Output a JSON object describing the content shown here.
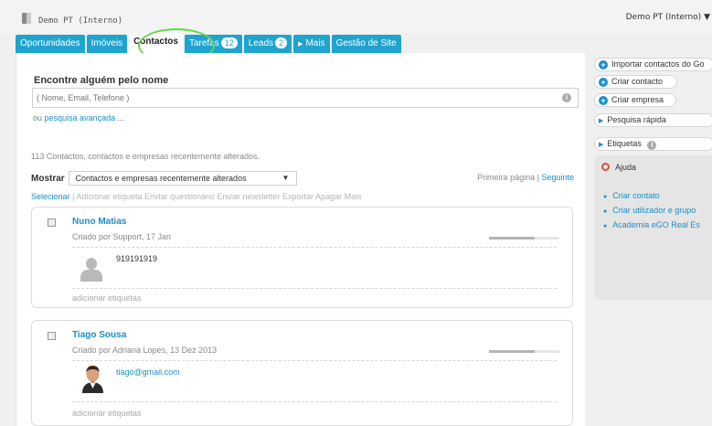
{
  "header": {
    "app_title": "Demo PT (Interno)",
    "account_select": "Demo PT (Interno)"
  },
  "tabs": [
    {
      "label": "Oportunidades"
    },
    {
      "label": "Imóveis"
    },
    {
      "label": "Contactos",
      "active": true
    },
    {
      "label": "Tarefas",
      "badge": "12"
    },
    {
      "label": "Leads",
      "badge": "2"
    },
    {
      "label": "Mais",
      "icon": "triangle-right-icon"
    },
    {
      "label": "Gestão de Site"
    }
  ],
  "search": {
    "title": "Encontre alguém pelo nome",
    "placeholder": "( Nome, Email, Telefone )",
    "or_text": "ou",
    "advanced_link": "pesquisa avançada ..."
  },
  "list": {
    "count_text": "113 Contactos, contactos e empresas recentemente alterados.",
    "show_label": "Mostrar",
    "show_value": "Contactos e empresas recentemente alterados",
    "pager_first": "Primeira página",
    "pager_sep": "|",
    "pager_next": "Seguinte",
    "actions": {
      "select": "Selecionar",
      "sep": "|",
      "rest": "Adicionar etiqueta Enviar questionário Enviar newsletter Exportar Apagar Mais"
    },
    "contacts": [
      {
        "name": "Nuno Matias",
        "meta": "Criado por Support, 17 Jan",
        "detail": "919191919",
        "tags": "adicionar etiquetas",
        "progress": 0.65
      },
      {
        "name": "Tiago Sousa",
        "meta": "Criado por Adriana Lopes, 13 Dez 2013",
        "detail": "tiago@gmail.com",
        "tags": "adicionar etiquetas",
        "progress": 0.65
      }
    ]
  },
  "sidebar": {
    "import": "Importar contactos do Go",
    "create_contact": "Criar contacto",
    "create_company": "Criar empresa",
    "quick_search": "Pesquisa rápida",
    "tags": "Etiquetas",
    "help": {
      "title": "Ajuda",
      "links": [
        "Criar contato",
        "Criar utilizador e grupo",
        "Academia eGO Real Es"
      ]
    }
  },
  "colors": {
    "accent": "#1fa3cf",
    "link": "#1a8ec8",
    "highlight_ring": "#62d649"
  }
}
